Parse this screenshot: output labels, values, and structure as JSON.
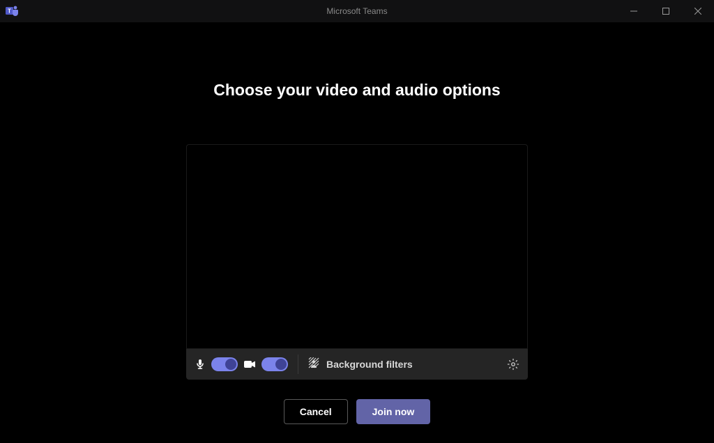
{
  "window": {
    "title": "Microsoft Teams"
  },
  "page": {
    "heading": "Choose your video and audio options"
  },
  "controls": {
    "mic_on": true,
    "camera_on": true,
    "background_filters_label": "Background filters"
  },
  "actions": {
    "cancel_label": "Cancel",
    "join_label": "Join now"
  },
  "colors": {
    "accent": "#6264a7",
    "toggle": "#7b83eb"
  }
}
